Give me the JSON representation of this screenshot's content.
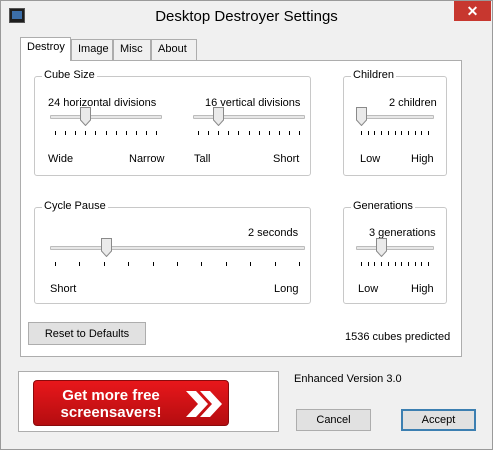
{
  "window": {
    "title": "Desktop Destroyer Settings",
    "close_glyph": "✕"
  },
  "tabs": [
    {
      "label": "Destroy",
      "active": true
    },
    {
      "label": "Image",
      "active": false
    },
    {
      "label": "Misc",
      "active": false
    },
    {
      "label": "About",
      "active": false
    }
  ],
  "cube_size": {
    "title": "Cube Size",
    "horizontal": {
      "value_label": "24 horizontal divisions",
      "min_label": "Wide",
      "max_label": "Narrow",
      "level": 0.3
    },
    "vertical": {
      "value_label": "16 vertical divisions",
      "min_label": "Tall",
      "max_label": "Short",
      "level": 0.2
    }
  },
  "children": {
    "title": "Children",
    "value_label": "2 children",
    "min_label": "Low",
    "max_label": "High",
    "level": 0.0
  },
  "cycle_pause": {
    "title": "Cycle Pause",
    "value_label": "2 seconds",
    "min_label": "Short",
    "max_label": "Long",
    "level": 0.21
  },
  "generations": {
    "title": "Generations",
    "value_label": "3 generations",
    "min_label": "Low",
    "max_label": "High",
    "level": 0.3
  },
  "reset_button": "Reset to Defaults",
  "cubes_predicted": "1536 cubes predicted",
  "banner": {
    "line1": "Get more free",
    "line2": "screensavers!",
    "color": "#d41418"
  },
  "version": "Enhanced Version 3.0",
  "buttons": {
    "cancel": "Cancel",
    "accept": "Accept"
  },
  "colors": {
    "accent": "#3c7fb1",
    "close": "#c7372f"
  }
}
